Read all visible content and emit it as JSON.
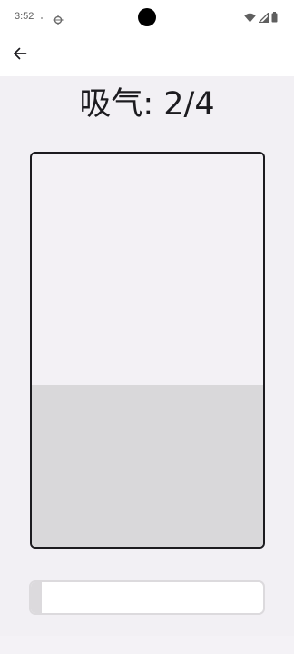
{
  "status_bar": {
    "time": "3:52",
    "icons": [
      "debug-icon",
      "wifi-icon",
      "signal-icon",
      "battery-icon"
    ]
  },
  "toolbar": {
    "back_icon": "arrow-left-icon"
  },
  "breathing": {
    "phase_text": "吸气: 2/4",
    "gauge_fill_fraction": 0.41,
    "progress_fraction": 0.045
  },
  "colors": {
    "background": "#f2f0f4",
    "gauge_border": "#1c1b1f",
    "gauge_fill": "#d9d8da",
    "progress_fill": "#dcdadd"
  }
}
